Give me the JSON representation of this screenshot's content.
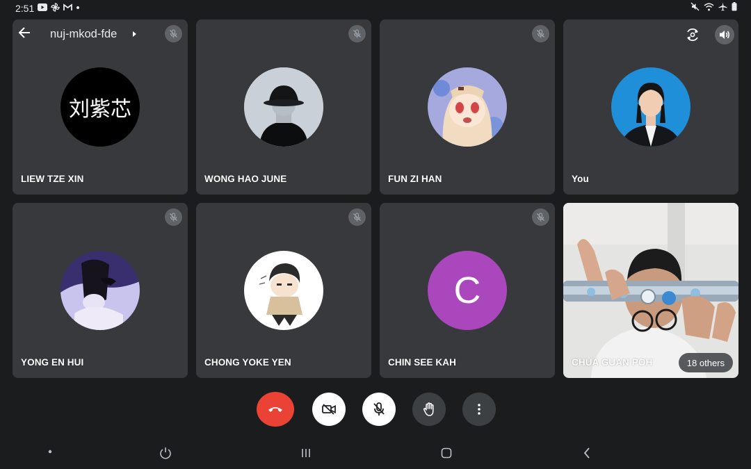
{
  "status_bar": {
    "time": "2:51",
    "left_icons": [
      "youtube-icon",
      "pinwheel-icon",
      "gmail-icon",
      "dot-icon"
    ],
    "right_icons": [
      "mute-icon",
      "wifi-icon",
      "airplane-icon",
      "battery-icon"
    ]
  },
  "meeting": {
    "code": "nuj-mkod-fde"
  },
  "tiles": [
    {
      "name": "LIEW TZE XIN",
      "avatar_text": "刘紫芯",
      "muted": true
    },
    {
      "name": "WONG HAO JUNE",
      "muted": true
    },
    {
      "name": "FUN ZI HAN",
      "muted": true
    },
    {
      "name": "You",
      "muted": false
    },
    {
      "name": "YONG EN HUI",
      "muted": true
    },
    {
      "name": "CHONG YOKE YEN",
      "muted": true
    },
    {
      "name": "CHIN SEE KAH",
      "avatar_letter": "C",
      "muted": true
    },
    {
      "name": "CHUA GUAN POH",
      "others": "18 others"
    }
  ],
  "colors": {
    "tile_bg": "#38393c",
    "end_call_red": "#ea4335",
    "chin_avatar_purple": "#ab47bc",
    "you_avatar_blue": "#1e8fd8"
  },
  "controls": [
    "end-call",
    "camera-off",
    "mic-off",
    "raise-hand",
    "more-options"
  ],
  "nav": [
    "dot",
    "power",
    "recents",
    "home",
    "back"
  ]
}
